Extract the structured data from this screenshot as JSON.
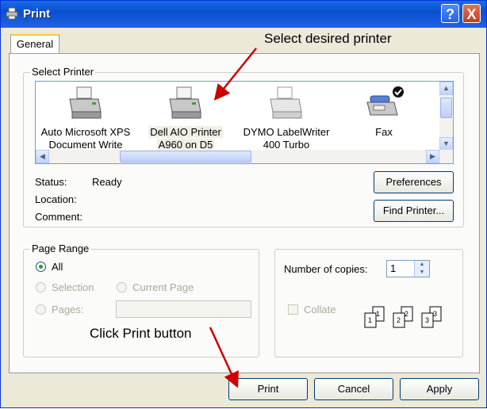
{
  "window": {
    "title": "Print",
    "help_label": "?",
    "close_label": "X"
  },
  "tabs": [
    {
      "label": "General"
    }
  ],
  "select_printer": {
    "legend": "Select Printer",
    "printers": [
      {
        "line1": "Auto Microsoft XPS",
        "line2": "Document Write"
      },
      {
        "line1": "Dell AIO Printer",
        "line2": "A960 on D5"
      },
      {
        "line1": "DYMO LabelWriter",
        "line2": "400 Turbo"
      },
      {
        "line1": "Fax",
        "line2": ""
      }
    ],
    "selected_index": 1,
    "status_label": "Status:",
    "status_value": "Ready",
    "location_label": "Location:",
    "comment_label": "Comment:",
    "preferences_button": "Preferences",
    "find_printer_button": "Find Printer..."
  },
  "page_range": {
    "legend": "Page Range",
    "all": "All",
    "selection": "Selection",
    "current_page": "Current Page",
    "pages": "Pages:",
    "pages_value": ""
  },
  "copies": {
    "label": "Number of copies:",
    "value": "1",
    "collate": "Collate"
  },
  "buttons": {
    "print": "Print",
    "cancel": "Cancel",
    "apply": "Apply"
  },
  "annotations": {
    "select_printer": "Select desired printer",
    "click_print": "Click Print button",
    "arrow_color": "#cc0000"
  }
}
